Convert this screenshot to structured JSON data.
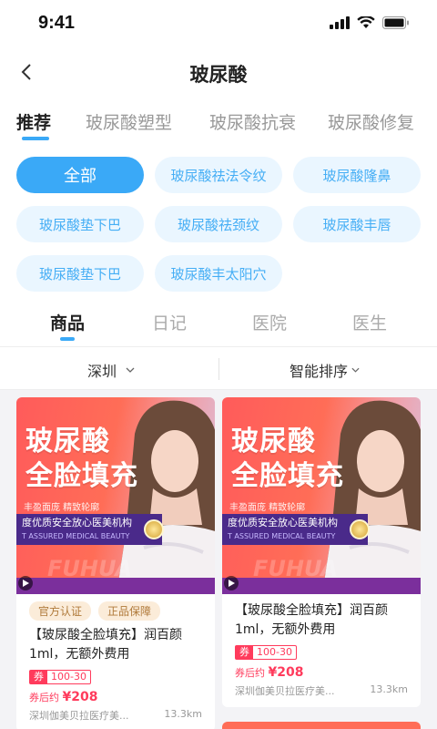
{
  "status": {
    "time": "9:41"
  },
  "nav": {
    "title": "玻尿酸"
  },
  "tabs": [
    {
      "label": "推荐"
    },
    {
      "label": "玻尿酸塑型"
    },
    {
      "label": "玻尿酸抗衰"
    },
    {
      "label": "玻尿酸修复"
    }
  ],
  "chips": [
    {
      "label": "全部"
    },
    {
      "label": "玻尿酸祛法令纹"
    },
    {
      "label": "玻尿酸隆鼻"
    },
    {
      "label": "玻尿酸垫下巴"
    },
    {
      "label": "玻尿酸祛颈纹"
    },
    {
      "label": "玻尿酸丰唇"
    },
    {
      "label": "玻尿酸垫下巴"
    },
    {
      "label": "玻尿酸丰太阳穴"
    }
  ],
  "subtabs": [
    {
      "label": "商品"
    },
    {
      "label": "日记"
    },
    {
      "label": "医院"
    },
    {
      "label": "医生"
    }
  ],
  "filters": {
    "city": "深圳",
    "sort": "智能排序"
  },
  "cards": [
    {
      "image": {
        "title_line1": "玻尿酸",
        "title_line2": "全脸填充",
        "subtitle": "丰盈面庞 精致轮廓",
        "band_text": "度优质安全放心医美机构",
        "band_sub": "T ASSURED MEDICAL BEAUTY",
        "watermark": "FUHUA"
      },
      "badges": [
        "官方认证",
        "正品保障"
      ],
      "title": "【玻尿酸全脸填充】润百颜1ml，无额外费用",
      "coupon_tag": "券",
      "coupon_range": "100-30",
      "price_label": "券后约",
      "price": "¥208",
      "clinic": "深圳伽美贝拉医疗美...",
      "distance": "13.3km"
    },
    {
      "image": {
        "title_line1": "玻尿酸",
        "title_line2": "全脸填充",
        "subtitle": "丰盈面庞 精致轮廓",
        "band_text": "度优质安全放心医美机构",
        "band_sub": "T ASSURED MEDICAL BEAUTY",
        "watermark": "FUHUA"
      },
      "badges": [],
      "title": "【玻尿酸全脸填充】润百颜1ml，无额外费用",
      "coupon_tag": "券",
      "coupon_range": "100-30",
      "price_label": "券后约",
      "price": "¥208",
      "clinic": "深圳伽美贝拉医疗美...",
      "distance": "13.3km"
    }
  ],
  "colors": {
    "accent": "#3aa9f7",
    "chip_bg": "#eaf6ff",
    "price_red": "#ff3b5c",
    "badge_bg": "#fbecd9"
  }
}
